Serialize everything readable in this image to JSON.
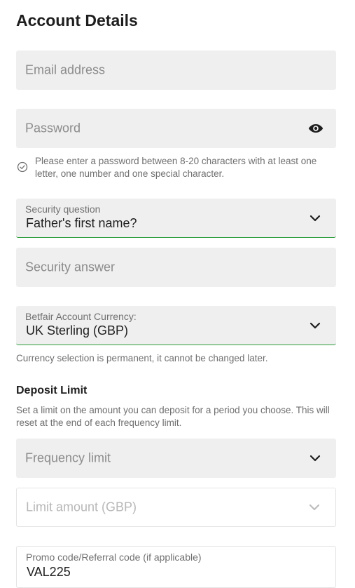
{
  "form": {
    "title": "Account Details",
    "email": {
      "placeholder": "Email address"
    },
    "password": {
      "placeholder": "Password",
      "hint": "Please enter a password between 8-20 characters with at least one letter, one number and one special character."
    },
    "security_question": {
      "label": "Security question",
      "value": "Father's first name?"
    },
    "security_answer": {
      "placeholder": "Security answer"
    },
    "currency": {
      "label": "Betfair Account Currency:",
      "value": "UK Sterling (GBP)",
      "note": "Currency selection is permanent, it cannot be changed later."
    }
  },
  "deposit_limit": {
    "title": "Deposit Limit",
    "description": "Set a limit on the amount you can deposit for a period you choose.  This will reset at the end of each frequency limit.",
    "frequency": {
      "placeholder": "Frequency limit"
    },
    "amount": {
      "placeholder": "Limit amount (GBP)"
    }
  },
  "promo": {
    "label": "Promo code/Referral code (if applicable)",
    "value": "VAL225"
  },
  "icons": {
    "password_toggle": "eye-icon",
    "hint": "check-circle-icon",
    "dropdown": "chevron-down-icon"
  },
  "colors": {
    "field_background": "#efefef",
    "select_underline": "#2e9e3e",
    "text_primary": "#1e1e1e",
    "text_secondary": "#6f6f6f",
    "placeholder": "#8c8c8c"
  }
}
